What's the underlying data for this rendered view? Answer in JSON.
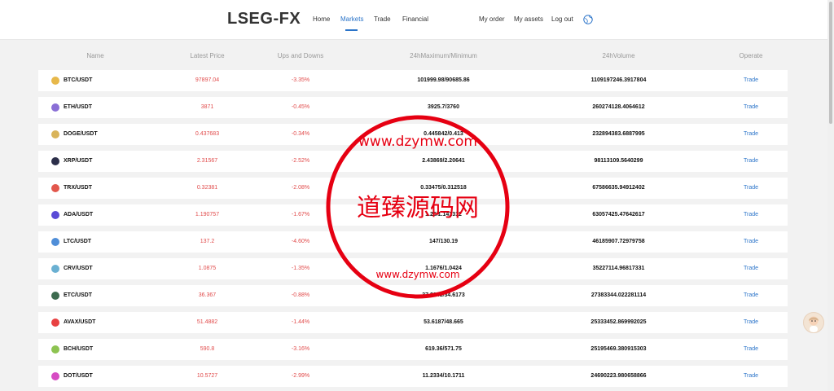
{
  "brand": "LSEG-FX",
  "nav": {
    "home": "Home",
    "markets": "Markets",
    "trade": "Trade",
    "financial": "Financial",
    "my_order": "My order",
    "my_assets": "My assets",
    "logout": "Log out"
  },
  "table": {
    "headers": [
      "Name",
      "Latest Price",
      "Ups and Downs",
      "24hMaximum/Minimum",
      "24hVolume",
      "Operate"
    ],
    "rows": [
      {
        "name": "BTC/USDT",
        "price": "97897.04",
        "change": "-3.35%",
        "range": "101999.98/90685.86",
        "volume": "1109197246.3917804",
        "action": "Trade",
        "icon_color": "#e7b84a"
      },
      {
        "name": "ETH/USDT",
        "price": "3871",
        "change": "-0.45%",
        "range": "3925.7/3760",
        "volume": "260274128.4064612",
        "action": "Trade",
        "icon_color": "#8a6fd6"
      },
      {
        "name": "DOGE/USDT",
        "price": "0.437683",
        "change": "-0.34%",
        "range": "0.445842/0.413",
        "volume": "232894383.6887995",
        "action": "Trade",
        "icon_color": "#d9b45a"
      },
      {
        "name": "XRP/USDT",
        "price": "2.31567",
        "change": "-2.52%",
        "range": "2.43869/2.20641",
        "volume": "98113109.5640299",
        "action": "Trade",
        "icon_color": "#2c2f4a"
      },
      {
        "name": "TRX/USDT",
        "price": "0.32381",
        "change": "-2.08%",
        "range": "0.33475/0.312518",
        "volume": "67586635.94912402",
        "action": "Trade",
        "icon_color": "#e2574c"
      },
      {
        "name": "ADA/USDT",
        "price": "1.190757",
        "change": "-1.67%",
        "range": "1.26/1.141312",
        "volume": "63057425.47642617",
        "action": "Trade",
        "icon_color": "#5a4bd6"
      },
      {
        "name": "LTC/USDT",
        "price": "137.2",
        "change": "-4.60%",
        "range": "147/130.19",
        "volume": "46185907.72979758",
        "action": "Trade",
        "icon_color": "#4f8ed8"
      },
      {
        "name": "CRV/USDT",
        "price": "1.0875",
        "change": "-1.35%",
        "range": "1.1676/1.0424",
        "volume": "35227114.96817331",
        "action": "Trade",
        "icon_color": "#6ab0d2"
      },
      {
        "name": "ETC/USDT",
        "price": "36.367",
        "change": "-0.88%",
        "range": "37.2941/34.6173",
        "volume": "27383344.022281114",
        "action": "Trade",
        "icon_color": "#3d6b4f"
      },
      {
        "name": "AVAX/USDT",
        "price": "51.4882",
        "change": "-1.44%",
        "range": "53.6187/48.665",
        "volume": "25333452.869992025",
        "action": "Trade",
        "icon_color": "#e84142"
      },
      {
        "name": "BCH/USDT",
        "price": "590.8",
        "change": "-3.16%",
        "range": "619.36/571.75",
        "volume": "25195469.380915303",
        "action": "Trade",
        "icon_color": "#8dc351"
      },
      {
        "name": "DOT/USDT",
        "price": "10.5727",
        "change": "-2.99%",
        "range": "11.2334/10.1711",
        "volume": "24690223.980658866",
        "action": "Trade",
        "icon_color": "#d64cc3"
      }
    ]
  },
  "watermark": {
    "main_text": "道臻源码网",
    "url_text": "www.dzymw.com"
  },
  "colors": {
    "accent": "#2b74c9",
    "down": "#e14b4b",
    "watermark": "#e60012"
  }
}
